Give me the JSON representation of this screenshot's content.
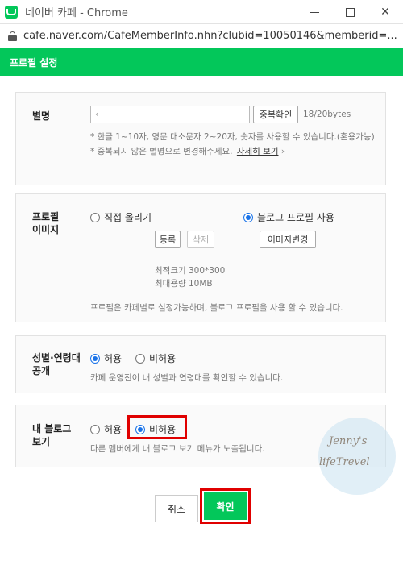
{
  "window": {
    "title": "네이버 카페 - Chrome"
  },
  "address": {
    "url": "cafe.naver.com/CafeMemberInfo.nhn?clubid=10050146&memberid=..."
  },
  "header": {
    "title": "프로필 설정"
  },
  "nickname": {
    "label": "별명",
    "value": "‹",
    "check_button": "중복확인",
    "byte_count": "18/20bytes",
    "hint1": "* 한글 1~10자, 영문 대소문자 2~20자, 숫자를 사용할 수 있습니다.(혼용가능)",
    "hint2": "* 중복되지 않은 별명으로 변경해주세요.",
    "more_link": "자세히 보기"
  },
  "profile_image": {
    "label_line1": "프로필",
    "label_line2": "이미지",
    "option_direct": "직접 올리기",
    "option_blog": "블로그 프로필 사용",
    "register_button": "등록",
    "delete_button": "삭제",
    "change_button": "이미지변경",
    "optimal_size": "최적크기 300*300",
    "max_size": "최대용량 10MB",
    "note": "프로필은 카페별로 설정가능하며, 블로그 프로필을 사용 할 수 있습니다."
  },
  "gender_age": {
    "label_line1": "성별·연령대",
    "label_line2": "공개",
    "option_allow": "허용",
    "option_deny": "비허용",
    "note": "카페 운영진이 내 성별과 연령대를 확인할 수 있습니다."
  },
  "blog_view": {
    "label_line1": "내 블로그",
    "label_line2": "보기",
    "option_allow": "허용",
    "option_deny": "비허용",
    "note": "다른 멤버에게 내 블로그 보기 메뉴가 노출됩니다."
  },
  "footer": {
    "cancel": "취소",
    "confirm": "확인"
  },
  "watermark": {
    "line1": "Jenny's",
    "line2": "lifeTrevel"
  },
  "colors": {
    "brand": "#03c75a",
    "highlight": "#e00000",
    "radio": "#1a73e8"
  }
}
